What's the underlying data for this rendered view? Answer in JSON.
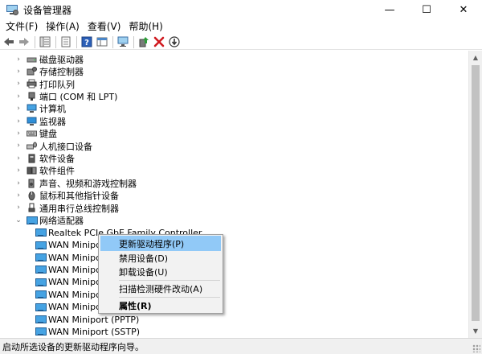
{
  "window": {
    "title": "设备管理器",
    "minimize_glyph": "—",
    "maximize_glyph": "☐",
    "close_glyph": "✕"
  },
  "menubar": {
    "items": [
      "文件(F)",
      "操作(A)",
      "查看(V)",
      "帮助(H)"
    ]
  },
  "toolbar": {
    "buttons": [
      {
        "name": "back-arrow-icon"
      },
      {
        "name": "forward-arrow-icon"
      },
      {
        "name": "device-list-icon"
      },
      {
        "name": "properties-sheet-icon"
      },
      {
        "name": "help-icon"
      },
      {
        "name": "view-table-icon"
      },
      {
        "name": "scan-monitor-icon"
      },
      {
        "name": "update-driver-icon"
      },
      {
        "name": "uninstall-x-icon"
      },
      {
        "name": "download-circle-icon"
      }
    ]
  },
  "tree": {
    "categories": [
      {
        "label": "磁盘驱动器",
        "icon": "disk-drive-icon",
        "expanded": false
      },
      {
        "label": "存储控制器",
        "icon": "storage-controller-icon",
        "expanded": false
      },
      {
        "label": "打印队列",
        "icon": "printer-icon",
        "expanded": false
      },
      {
        "label": "端口 (COM 和 LPT)",
        "icon": "port-icon",
        "expanded": false
      },
      {
        "label": "计算机",
        "icon": "computer-icon",
        "expanded": false
      },
      {
        "label": "监视器",
        "icon": "monitor-icon",
        "expanded": false
      },
      {
        "label": "键盘",
        "icon": "keyboard-icon",
        "expanded": false
      },
      {
        "label": "人机接口设备",
        "icon": "hid-icon",
        "expanded": false
      },
      {
        "label": "软件设备",
        "icon": "software-device-icon",
        "expanded": false
      },
      {
        "label": "软件组件",
        "icon": "software-component-icon",
        "expanded": false
      },
      {
        "label": "声音、视频和游戏控制器",
        "icon": "speaker-icon",
        "expanded": false
      },
      {
        "label": "鼠标和其他指针设备",
        "icon": "mouse-icon",
        "expanded": false
      },
      {
        "label": "通用串行总线控制器",
        "icon": "usb-icon",
        "expanded": false
      },
      {
        "label": "网络适配器",
        "icon": "network-adapter-icon",
        "expanded": true
      }
    ],
    "network_children": [
      "Realtek PCIe GbE Family Controller",
      "WAN Minipc",
      "WAN Minipc",
      "WAN Minipc",
      "WAN Minipc",
      "WAN Minipc",
      "WAN Minipc",
      "WAN Miniport (PPTP)",
      "WAN Miniport (SSTP)"
    ]
  },
  "context_menu": {
    "update_driver": "更新驱动程序(P)",
    "disable_device": "禁用设备(D)",
    "uninstall_device": "卸载设备(U)",
    "scan_hardware": "扫描检测硬件改动(A)",
    "properties": "属性(R)"
  },
  "statusbar": {
    "text": "启动所选设备的更新驱动程序向导。"
  },
  "colors": {
    "highlight": "#91c9f7",
    "menu_bg": "#f2f2f2",
    "statusbar_bg": "#f0f0f0",
    "network_icon": "#46a3e3"
  }
}
